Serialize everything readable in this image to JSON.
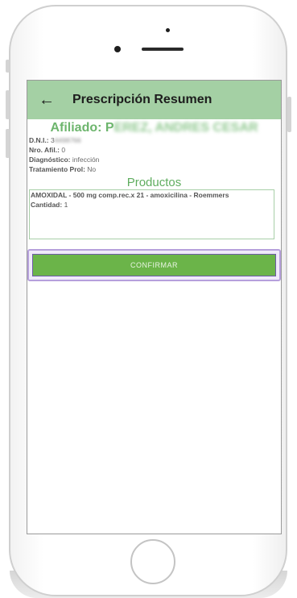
{
  "appbar": {
    "back_icon": "arrow-left-icon",
    "title": "Prescripción Resumen"
  },
  "afiliado": {
    "label": "Afiliado: ",
    "name_visible": "P",
    "name_blurred": "EREZ, ANDRES CESAR"
  },
  "fields": {
    "dni_label": "D.N.I.:",
    "dni_value": "3",
    "dni_blurred": "4498766",
    "nro_label": "Nro. Afil.:",
    "nro_value": "0",
    "diag_label": "Diagnóstico:",
    "diag_value": "infección",
    "trat_label": "Tratamiento Prol:",
    "trat_value": "No"
  },
  "productos": {
    "heading": "Productos",
    "item_name": "AMOXIDAL - 500 mg comp.rec.x 21 - amoxicilina - Roemmers",
    "qty_label": "Cantidad:",
    "qty_value": "1"
  },
  "confirm_label": "CONFIRMAR",
  "colors": {
    "appbar": "#a4d0a4",
    "accent_text": "#6db56d",
    "confirm_button": "#6bb449",
    "highlight": "#b6a0dc"
  }
}
